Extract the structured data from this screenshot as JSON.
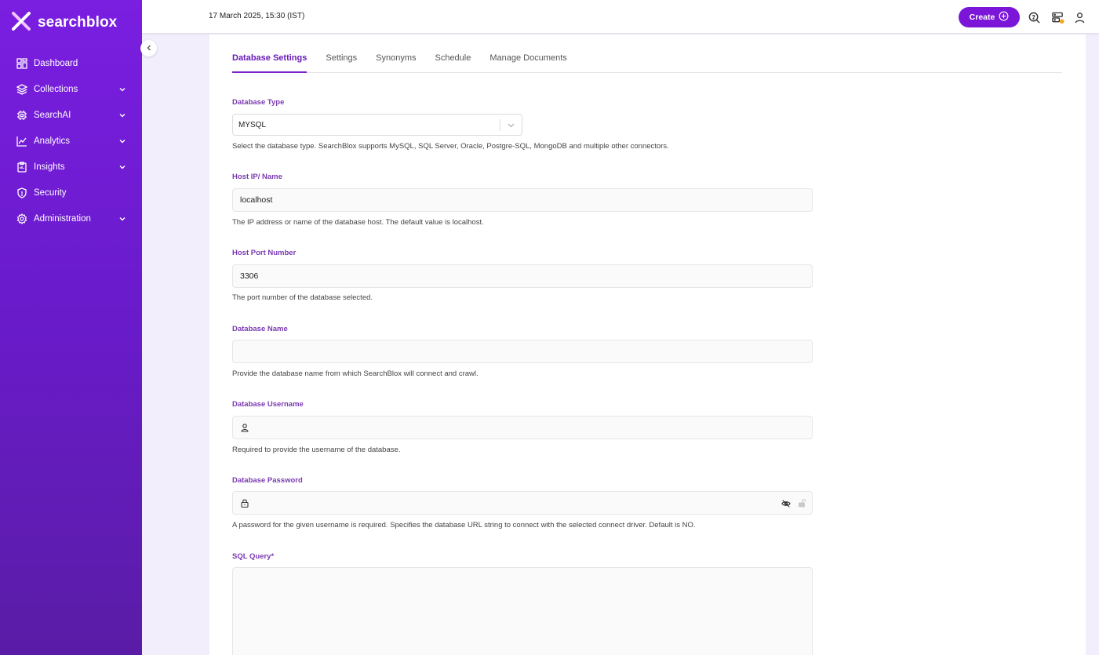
{
  "brand": {
    "name": "searchblox"
  },
  "sidebar": {
    "items": [
      {
        "label": "Dashboard",
        "icon": "dashboard-icon",
        "expandable": false
      },
      {
        "label": "Collections",
        "icon": "layers-icon",
        "expandable": true
      },
      {
        "label": "SearchAI",
        "icon": "chip-icon",
        "expandable": true
      },
      {
        "label": "Analytics",
        "icon": "chart-icon",
        "expandable": true
      },
      {
        "label": "Insights",
        "icon": "clipboard-icon",
        "expandable": true
      },
      {
        "label": "Security",
        "icon": "shield-icon",
        "expandable": false
      },
      {
        "label": "Administration",
        "icon": "gear-icon",
        "expandable": true
      }
    ]
  },
  "header": {
    "datetime": "17 March 2025, 15:30 (IST)",
    "create_label": "Create"
  },
  "tabs": [
    {
      "label": "Database Settings",
      "active": true
    },
    {
      "label": "Settings",
      "active": false
    },
    {
      "label": "Synonyms",
      "active": false
    },
    {
      "label": "Schedule",
      "active": false
    },
    {
      "label": "Manage Documents",
      "active": false
    }
  ],
  "form": {
    "db_type": {
      "label": "Database Type",
      "value": "MYSQL",
      "help": "Select the database type. SearchBlox supports MySQL, SQL Server, Oracle, Postgre-SQL, MongoDB and multiple other connectors."
    },
    "host": {
      "label": "Host IP/ Name",
      "value": "localhost",
      "help": "The IP address or name of the database host. The default value is localhost."
    },
    "port": {
      "label": "Host Port Number",
      "value": "3306",
      "help": "The port number of the database selected."
    },
    "db_name": {
      "label": "Database Name",
      "value": "",
      "help": "Provide the database name from which SearchBlox will connect and crawl."
    },
    "username": {
      "label": "Database Username",
      "value": "",
      "help": "Required to provide the username of the database."
    },
    "password": {
      "label": "Database Password",
      "value": "",
      "help": "A password for the given username is required. Specifies the database URL string to connect with the selected connect driver. Default is NO."
    },
    "sql_query": {
      "label": "SQL Query*",
      "value": ""
    }
  },
  "colors": {
    "accent": "#7b16d8",
    "sidebar_top": "#7a1ee0",
    "sidebar_bottom": "#5a1ca6",
    "label": "#7a3ab0"
  }
}
